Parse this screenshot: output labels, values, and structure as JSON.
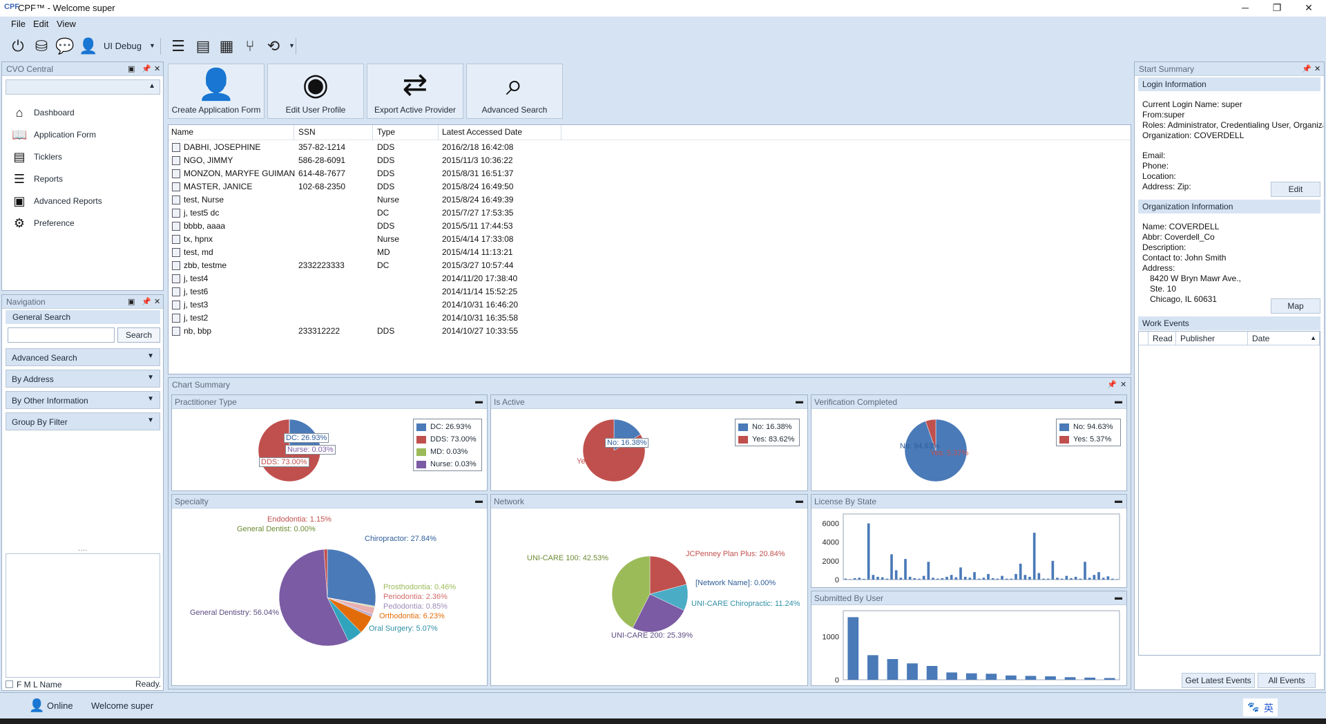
{
  "window": {
    "logo": "CPF",
    "title": "CPF™ - Welcome super",
    "minimize": "─",
    "restore": "❐",
    "close": "✕"
  },
  "menu": {
    "file": "File",
    "edit": "Edit",
    "view": "View"
  },
  "toolbar": {
    "ui_debug_label": "UI Debug"
  },
  "cvo_central": {
    "title": "CVO Central",
    "items": [
      {
        "label": "Dashboard",
        "icon": "home-icon"
      },
      {
        "label": "Application Form",
        "icon": "book-icon"
      },
      {
        "label": "Ticklers",
        "icon": "ticklers-icon"
      },
      {
        "label": "Reports",
        "icon": "list-icon"
      },
      {
        "label": "Advanced Reports",
        "icon": "report-icon"
      },
      {
        "label": "Preference",
        "icon": "gears-icon"
      }
    ]
  },
  "navigation": {
    "title": "Navigation",
    "general_search": "General Search",
    "search_button": "Search",
    "sections": [
      "Advanced Search",
      "By Address",
      "By Other Information",
      "Group By Filter"
    ],
    "fml_label": "F M L Name",
    "status": "Ready."
  },
  "actions": {
    "create_application_form": "Create Application Form",
    "edit_user_profile": "Edit User Profile",
    "export_active_provider": "Export Active Provider",
    "advanced_search": "Advanced Search"
  },
  "grid": {
    "headers": {
      "name": "Name",
      "ssn": "SSN",
      "type": "Type",
      "date": "Latest Accessed Date"
    },
    "rows": [
      {
        "name": "DABHI, JOSEPHINE",
        "ssn": "357-82-1214",
        "type": "DDS",
        "date": "2016/2/18 16:42:08"
      },
      {
        "name": "NGO, JIMMY",
        "ssn": "586-28-6091",
        "type": "DDS",
        "date": "2015/11/3 10:36:22"
      },
      {
        "name": "MONZON, MARYFE GUIMAN",
        "ssn": "614-48-7677",
        "type": "DDS",
        "date": "2015/8/31 16:51:37"
      },
      {
        "name": "MASTER, JANICE",
        "ssn": "102-68-2350",
        "type": "DDS",
        "date": "2015/8/24 16:49:50"
      },
      {
        "name": "test, Nurse",
        "ssn": "",
        "type": "Nurse",
        "date": "2015/8/24 16:49:39"
      },
      {
        "name": "j, test5 dc",
        "ssn": "",
        "type": "DC",
        "date": "2015/7/27 17:53:35"
      },
      {
        "name": "bbbb, aaaa",
        "ssn": "",
        "type": "DDS",
        "date": "2015/5/11 17:44:53"
      },
      {
        "name": "tx, hpnx",
        "ssn": "",
        "type": "Nurse",
        "date": "2015/4/14 17:33:08"
      },
      {
        "name": "test, md",
        "ssn": "",
        "type": "MD",
        "date": "2015/4/14 11:13:21"
      },
      {
        "name": "zbb, testme",
        "ssn": "2332223333",
        "type": "DC",
        "date": "2015/3/27 10:57:44"
      },
      {
        "name": "j, test4",
        "ssn": "",
        "type": "",
        "date": "2014/11/20 17:38:40"
      },
      {
        "name": "j, test6",
        "ssn": "",
        "type": "",
        "date": "2014/11/14 15:52:25"
      },
      {
        "name": "j, test3",
        "ssn": "",
        "type": "",
        "date": "2014/10/31 16:46:20"
      },
      {
        "name": "j, test2",
        "ssn": "",
        "type": "",
        "date": "2014/10/31 16:35:58"
      },
      {
        "name": "nb, bbp",
        "ssn": "233312222",
        "type": "DDS",
        "date": "2014/10/27 10:33:55"
      }
    ]
  },
  "chart_summary": {
    "title": "Chart Summary"
  },
  "chart_data": [
    {
      "type": "pie",
      "title": "Practitioner Type",
      "slices": [
        {
          "label": "DC",
          "value": 26.93,
          "color": "#4a7ab8",
          "text": "DC: 26.93%"
        },
        {
          "label": "DDS",
          "value": 73.0,
          "color": "#c0504d",
          "text": "DDS: 73.00%"
        },
        {
          "label": "MD",
          "value": 0.03,
          "color": "#9bbb59",
          "text": "MD: 0.03%"
        },
        {
          "label": "Nurse",
          "value": 0.03,
          "color": "#7b5ba4",
          "text": "Nurse: 0.03%"
        }
      ]
    },
    {
      "type": "pie",
      "title": "Is Active",
      "slices": [
        {
          "label": "No",
          "value": 16.38,
          "color": "#4a7ab8",
          "text": "No: 16.38%"
        },
        {
          "label": "Yes",
          "value": 83.62,
          "color": "#c0504d",
          "text": "Yes: 83.62%"
        }
      ]
    },
    {
      "type": "pie",
      "title": "Verification Completed",
      "slices": [
        {
          "label": "No",
          "value": 94.63,
          "color": "#4a7ab8",
          "text": "No: 94.63%"
        },
        {
          "label": "Yes",
          "value": 5.37,
          "color": "#c0504d",
          "text": "Yes: 5.37%"
        }
      ]
    },
    {
      "type": "pie",
      "title": "Specialty",
      "slices": [
        {
          "label": "Chiropractor",
          "value": 27.84,
          "color": "#4a7ab8",
          "text": "Chiropractor: 27.84%"
        },
        {
          "label": "Prosthodontia",
          "value": 0.46,
          "color": "#c6d6a4",
          "text": "Prosthodontia: 0.46%"
        },
        {
          "label": "Periodontia",
          "value": 2.36,
          "color": "#e8b0b0",
          "text": "Periodontia: 2.36%"
        },
        {
          "label": "Pedodontia",
          "value": 0.85,
          "color": "#b7a8cf",
          "text": "Pedodontia: 0.85%"
        },
        {
          "label": "Orthodontia",
          "value": 6.23,
          "color": "#e36c0a",
          "text": "Orthodontia: 6.23%"
        },
        {
          "label": "Oral Surgery",
          "value": 5.07,
          "color": "#31a4bd",
          "text": "Oral Surgery: 5.07%"
        },
        {
          "label": "General Dentistry",
          "value": 56.04,
          "color": "#7b5ba4",
          "text": "General Dentistry: 56.04%"
        },
        {
          "label": "General Dentist",
          "value": 0.0,
          "color": "#9bbb59",
          "text": "General Dentist: 0.00%"
        },
        {
          "label": "Endodontia",
          "value": 1.15,
          "color": "#c0504d",
          "text": "Endodontia: 1.15%"
        }
      ]
    },
    {
      "type": "pie",
      "title": "Network",
      "slices": [
        {
          "label": "JCPenney Plan Plus",
          "value": 20.84,
          "color": "#c0504d",
          "text": "JCPenney Plan Plus: 20.84%"
        },
        {
          "label": "[Network Name]",
          "value": 0.0,
          "color": "#4a7ab8",
          "text": "[Network Name]: 0.00%"
        },
        {
          "label": "UNI-CARE Chiropractic",
          "value": 11.24,
          "color": "#4bacc6",
          "text": "UNI-CARE Chiropractic: 11.24%"
        },
        {
          "label": "UNI-CARE 200",
          "value": 25.39,
          "color": "#7b5ba4",
          "text": "UNI-CARE 200: 25.39%"
        },
        {
          "label": "UNI-CARE 100",
          "value": 42.53,
          "color": "#9bbb59",
          "text": "UNI-CARE 100: 42.53%"
        }
      ]
    },
    {
      "type": "bar",
      "title": "License By State",
      "ylim": [
        0,
        7000
      ],
      "yticks": [
        "6000",
        "4000",
        "2000",
        "0"
      ],
      "ytick_values": [
        6000,
        4000,
        2000,
        0
      ],
      "values": [
        100,
        50,
        150,
        200,
        80,
        6000,
        500,
        300,
        250,
        100,
        2700,
        1000,
        200,
        2200,
        300,
        150,
        100,
        400,
        1900,
        200,
        100,
        150,
        300,
        500,
        250,
        1300,
        300,
        200,
        800,
        100,
        200,
        600,
        150,
        100,
        400,
        100,
        100,
        600,
        1700,
        500,
        300,
        5000,
        700,
        100,
        100,
        2000,
        200,
        100,
        400,
        150,
        300,
        100,
        1900,
        200,
        500,
        800,
        200,
        350,
        100,
        50
      ]
    },
    {
      "type": "bar",
      "title": "Submitted By User",
      "ylim": [
        0,
        1600
      ],
      "yticks": [
        "1000",
        "0"
      ],
      "ytick_values": [
        1000,
        0
      ],
      "values": [
        1450,
        570,
        480,
        380,
        320,
        170,
        150,
        140,
        100,
        90,
        80,
        60,
        50,
        40
      ]
    }
  ],
  "start_summary": {
    "title": "Start Summary",
    "login_info_title": "Login Information",
    "login_lines": [
      "Current Login Name: super",
      "From:super",
      "Roles: Administrator, Credentialing User, Organization Admin",
      "Organization: COVERDELL"
    ],
    "contact_lines": [
      "Email:",
      "Phone:",
      "Location:",
      "Address:  Zip:"
    ],
    "edit_button": "Edit",
    "org_info_title": "Organization Information",
    "org_lines": [
      "Name: COVERDELL",
      "Abbr: Coverdell_Co",
      "Description:",
      "Contact to: John Smith",
      "Address:"
    ],
    "org_address_lines": [
      "8420 W Bryn Mawr Ave.,",
      "Ste. 10",
      "Chicago, IL 60631"
    ],
    "map_button": "Map",
    "work_events_title": "Work Events",
    "we_headers": {
      "read": "Read",
      "publisher": "Publisher",
      "date": "Date"
    },
    "get_latest_events": "Get Latest Events",
    "all_events": "All Events"
  },
  "status": {
    "online": "Online",
    "welcome": "Welcome super",
    "ime": "英"
  }
}
